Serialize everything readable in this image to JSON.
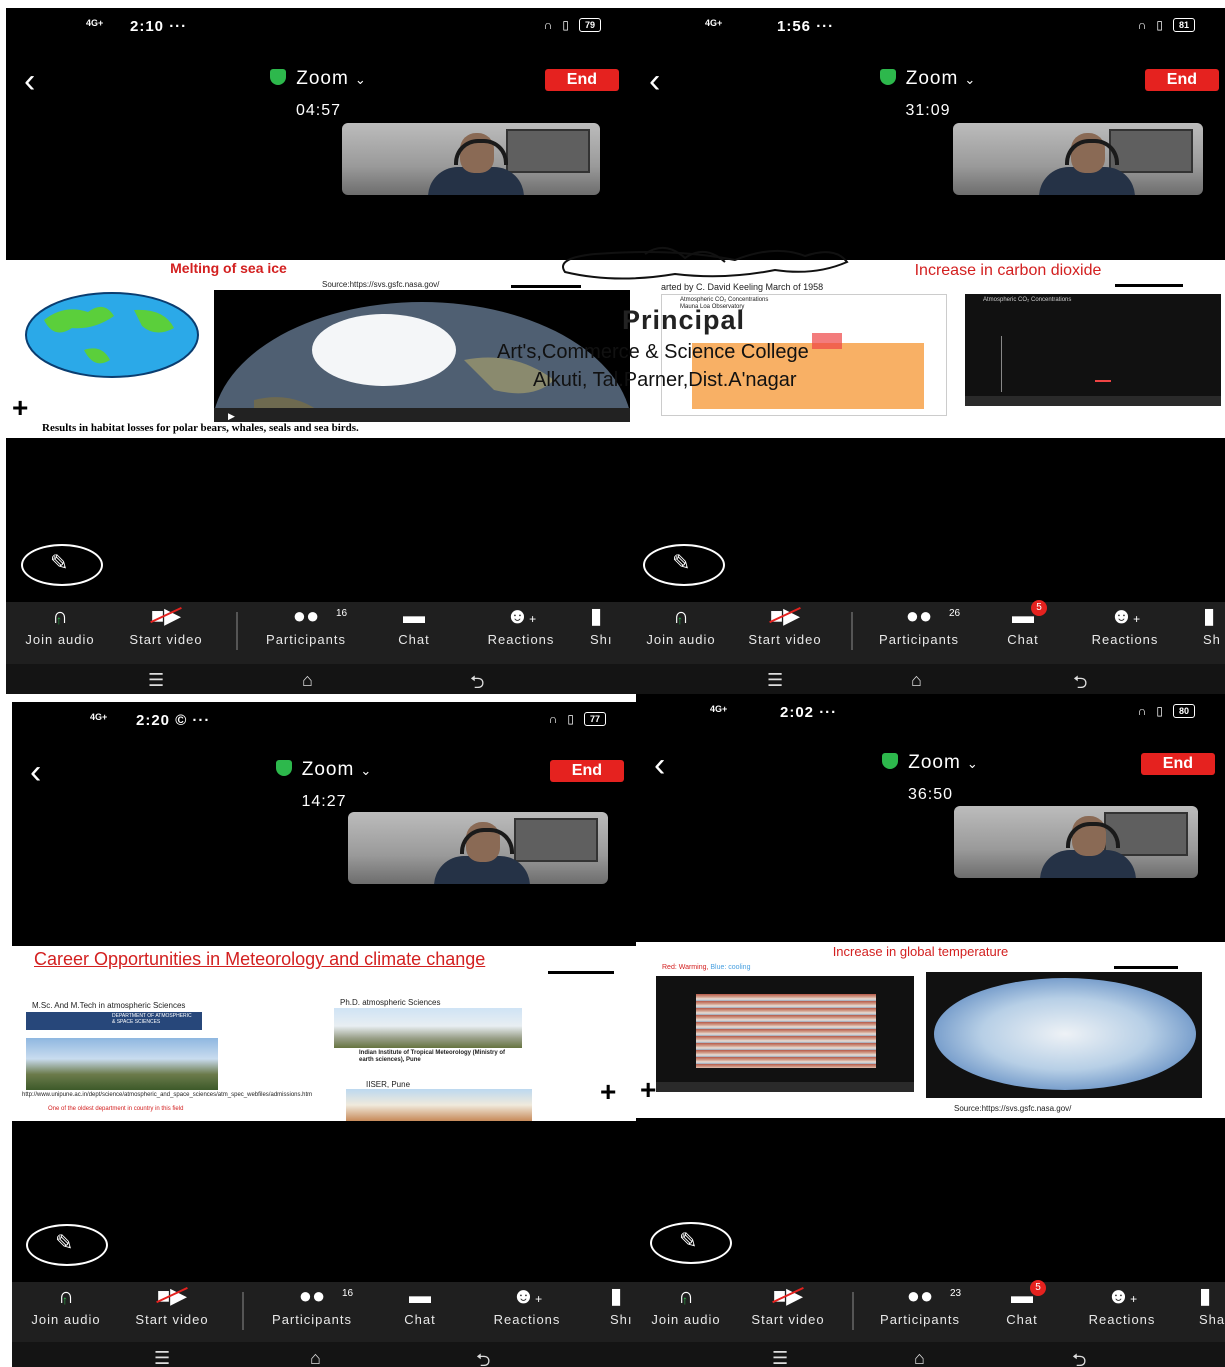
{
  "panels": [
    {
      "status": {
        "network": "4G+",
        "time": "2:10 ···",
        "battery": "79"
      },
      "meeting": {
        "app_name": "Zoom",
        "end_label": "End",
        "timer": "04:57"
      },
      "slide": {
        "title": "Melting of sea ice",
        "source": "Source:https://svs.gsfc.nasa.gov/",
        "caption": "Results in habitat losses for polar bears, whales, seals and sea birds."
      },
      "toolbar": {
        "join_audio": "Join audio",
        "start_video": "Start video",
        "participants": "Participants",
        "participants_count": "16",
        "chat": "Chat",
        "chat_badge": "",
        "reactions": "Reactions",
        "share": "Shı"
      }
    },
    {
      "status": {
        "network": "4G+",
        "time": "1:56 ···",
        "battery": "81"
      },
      "meeting": {
        "app_name": "Zoom",
        "end_label": "End",
        "timer": "31:09"
      },
      "slide": {
        "title": "Increase in carbon dioxide",
        "subtitle": "arted by C. David Keeling March of 1958",
        "chart_title_left": "Atmospheric CO₂ Concentrations",
        "chart_sub_left": "Mauna Loa Observatory",
        "chart_title_right": "Atmospheric CO₂ Concentrations"
      },
      "toolbar": {
        "join_audio": "Join audio",
        "start_video": "Start video",
        "participants": "Participants",
        "participants_count": "26",
        "chat": "Chat",
        "chat_badge": "5",
        "reactions": "Reactions",
        "share": "Sh"
      }
    },
    {
      "status": {
        "network": "4G+",
        "time": "2:20 © ···",
        "battery": "77"
      },
      "meeting": {
        "app_name": "Zoom",
        "end_label": "End",
        "timer": "14:27"
      },
      "slide": {
        "title": "Career Opportunities in Meteorology and climate change",
        "left_heading": "M.Sc. And M.Tech in atmospheric Sciences",
        "dept_label": "DEPARTMENT OF ATMOSPHERIC & SPACE SCIENCES",
        "url": "http://www.unipune.ac.in/dept/science/atmospheric_and_space_sciences/atm_spec_webfiles/admissions.htm",
        "note": "One of the oldest department in country in this field",
        "right_heading": "Ph.D. atmospheric Sciences",
        "iitm": "Indian Institute of Tropical Meteorology (Ministry of earth sciences), Pune",
        "iiser": "IISER, Pune"
      },
      "toolbar": {
        "join_audio": "Join audio",
        "start_video": "Start video",
        "participants": "Participants",
        "participants_count": "16",
        "chat": "Chat",
        "chat_badge": "",
        "reactions": "Reactions",
        "share": "Shı"
      }
    },
    {
      "status": {
        "network": "4G+",
        "time": "2:02 ···",
        "battery": "80"
      },
      "meeting": {
        "app_name": "Zoom",
        "end_label": "End",
        "timer": "36:50"
      },
      "slide": {
        "title": "Increase in global temperature",
        "legend_red": "Red: Warming,",
        "legend_blue": "Blue: cooling",
        "source": "Source:https://svs.gsfc.nasa.gov/"
      },
      "toolbar": {
        "join_audio": "Join audio",
        "start_video": "Start video",
        "participants": "Participants",
        "participants_count": "23",
        "chat": "Chat",
        "chat_badge": "5",
        "reactions": "Reactions",
        "share": "Sha"
      }
    }
  ],
  "stamp": {
    "line1": "Principal",
    "line2": "Art's,Commerce & Science College",
    "line3": "Alkuti, Tal.Parner,Dist.A'nagar"
  },
  "colors": {
    "end_button": "#e5221f",
    "shield": "#2db84c",
    "slide_title_red": "#d32020"
  }
}
